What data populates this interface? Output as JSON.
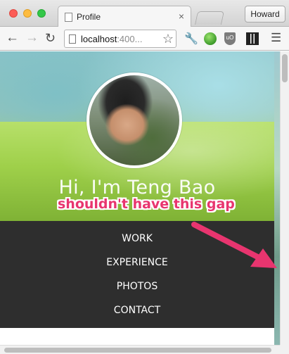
{
  "browser": {
    "tab_title": "Profile",
    "tab_close": "×",
    "user_button": "Howard",
    "url_host": "localhost",
    "url_rest": ":400...",
    "icons": [
      "back-arrow-icon",
      "forward-arrow-icon",
      "reload-icon",
      "page-icon",
      "bookmark-star-icon",
      "wrench-icon",
      "globe-icon",
      "ublock-icon",
      "qr-code-icon",
      "menu-icon"
    ],
    "ublock_text": "uO"
  },
  "page": {
    "hero_title": "Hi, I'm Teng Bao",
    "nav": {
      "work": "WORK",
      "experience": "EXPERIENCE",
      "photos": "PHOTOS",
      "contact": "CONTACT"
    }
  },
  "annotation": {
    "label": "shouldn't have this gap",
    "color": "#e8356f"
  },
  "colors": {
    "nav_panel": "#2e2e2e",
    "hero_green": "#9fd04a"
  }
}
